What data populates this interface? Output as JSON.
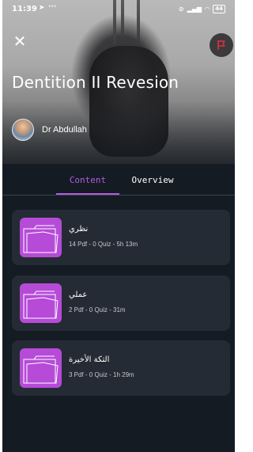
{
  "status_bar": {
    "time": "11:39",
    "icons": [
      "telegram-icon",
      "more-icon"
    ],
    "right_icons": [
      "mute-icon",
      "signal-icon",
      "wifi-icon"
    ],
    "battery": "44"
  },
  "header": {
    "close_icon": "close-icon",
    "flag_icon": "flag-icon",
    "title": "Dentition II Revesion",
    "author": "Dr Abdullah"
  },
  "tabs": [
    {
      "label": "Content",
      "active": true
    },
    {
      "label": "Overview",
      "active": false
    }
  ],
  "colors": {
    "accent": "#b35be6",
    "thumb": "#b64bd8",
    "card_bg": "#242b34",
    "page_bg": "#151b23",
    "flag": "#e0303a"
  },
  "sections": [
    {
      "title": "نظري",
      "meta": "14 Pdf - 0 Quiz - 5h 13m"
    },
    {
      "title": "عملي",
      "meta": "2 Pdf - 0 Quiz - 31m"
    },
    {
      "title": "التكة الأخيرة",
      "meta": "3 Pdf - 0 Quiz - 1h 29m"
    }
  ]
}
